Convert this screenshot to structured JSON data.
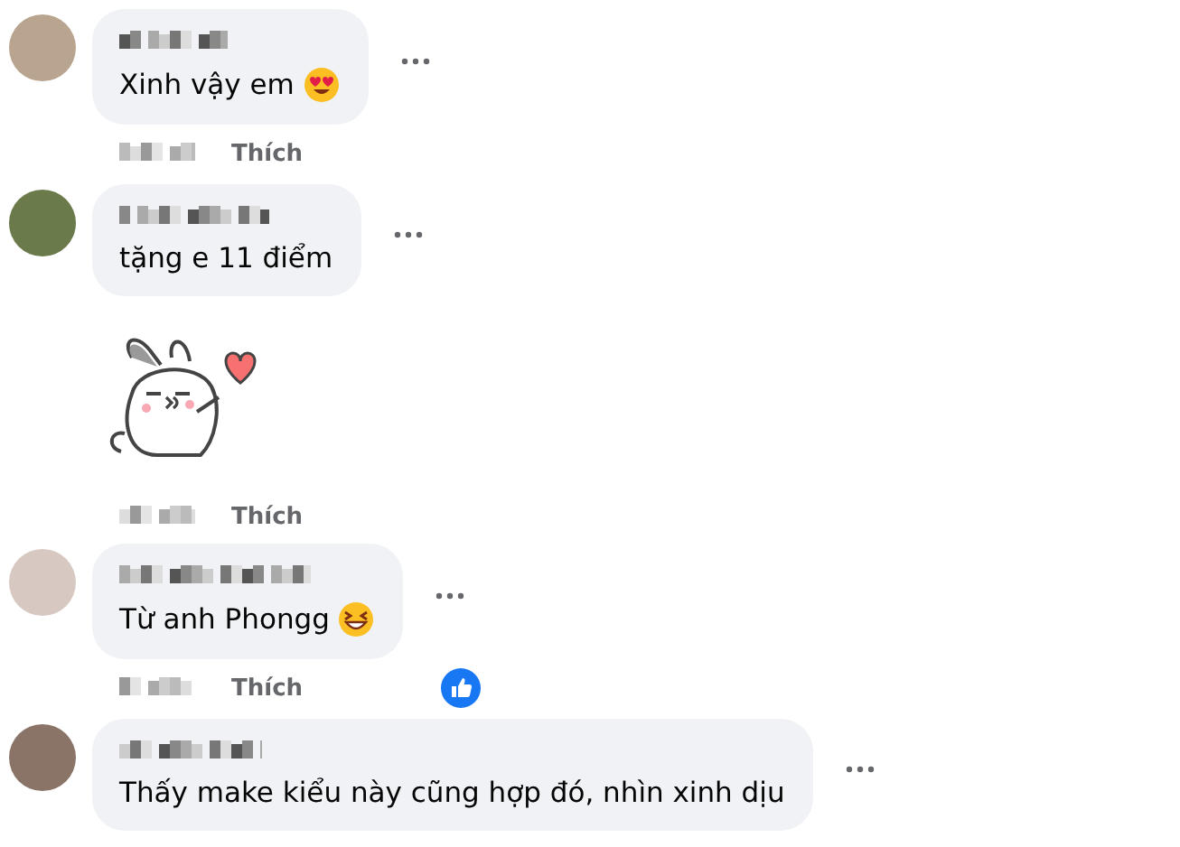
{
  "comments": [
    {
      "text": "Xinh vậy em",
      "emoji": {
        "kind": "love"
      },
      "actions": {
        "like_label": "Thích"
      }
    },
    {
      "text": "tặng e 11 điểm",
      "sticker": true,
      "actions": {
        "like_label": "Thích"
      }
    },
    {
      "text": "Từ anh Phongg",
      "emoji": {
        "kind": "laugh"
      },
      "actions": {
        "like_label": "Thích",
        "liked": true
      }
    },
    {
      "text": "Thấy make kiểu này cũng hợp đó, nhìn xinh dịu"
    }
  ]
}
